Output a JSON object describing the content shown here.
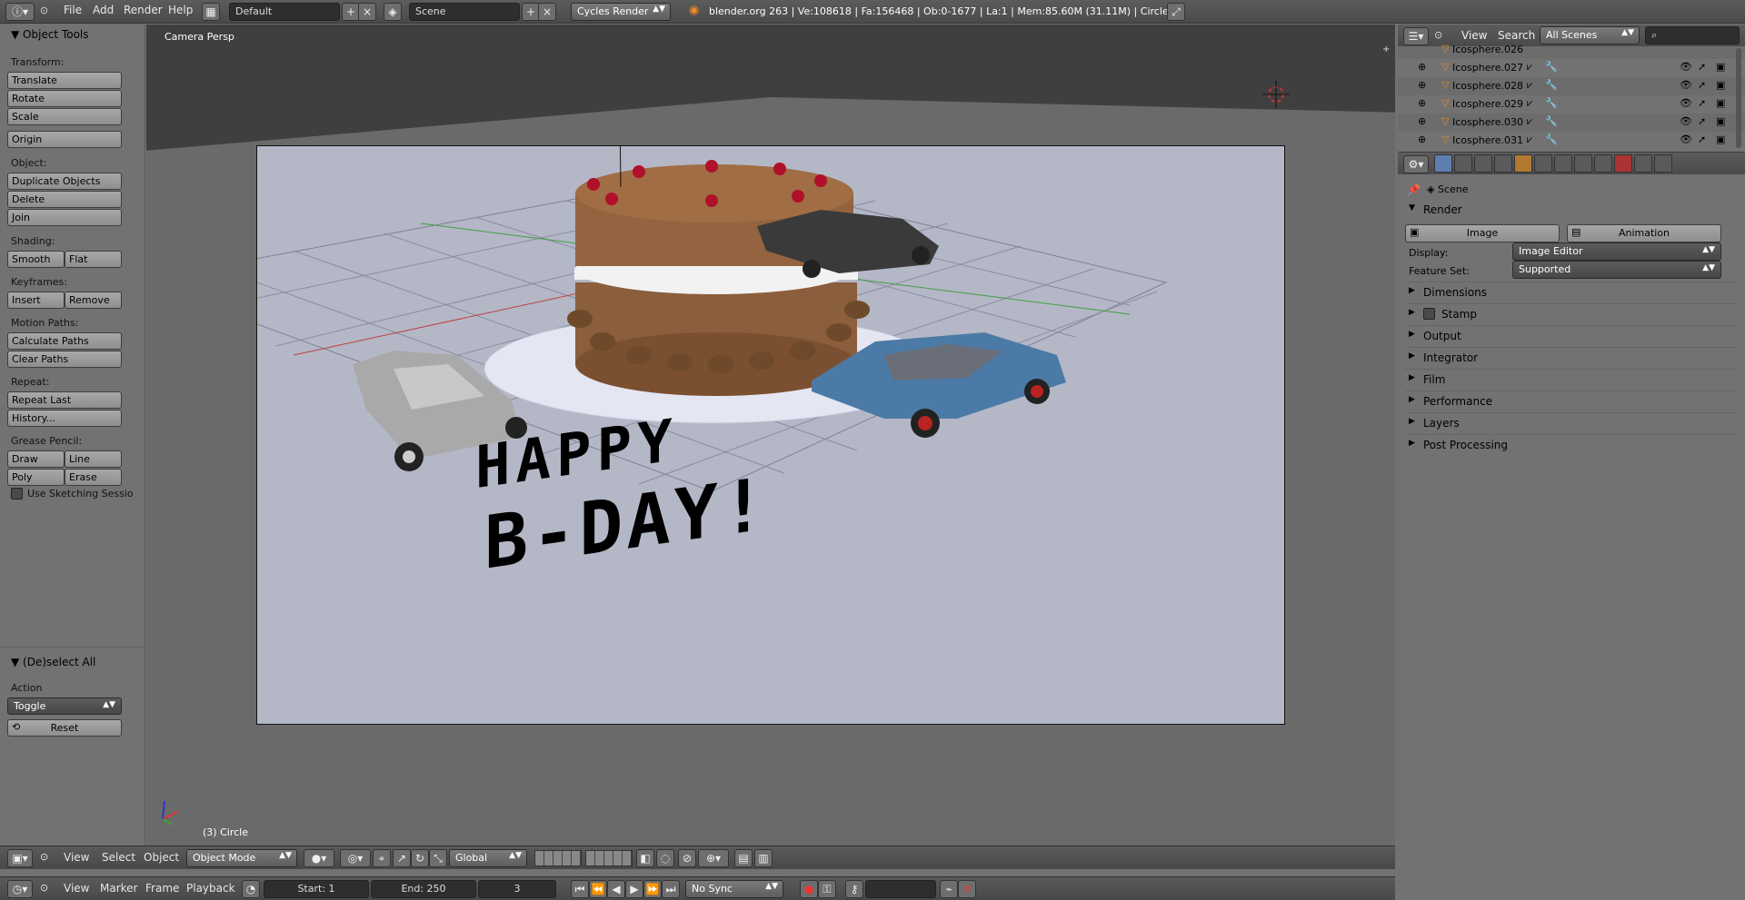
{
  "topbar": {
    "menus": [
      "File",
      "Add",
      "Render",
      "Help"
    ],
    "screen_layout": "Default",
    "scene": "Scene",
    "engine": "Cycles Render",
    "stats": "blender.org 263 | Ve:108618 | Fa:156468 | Ob:0-1677 | La:1 | Mem:85.60M (31.11M) | Circle"
  },
  "tools": {
    "title": "Object Tools",
    "transform_label": "Transform:",
    "translate": "Translate",
    "rotate": "Rotate",
    "scale": "Scale",
    "origin": "Origin",
    "object_label": "Object:",
    "duplicate": "Duplicate Objects",
    "delete": "Delete",
    "join": "Join",
    "shading_label": "Shading:",
    "smooth": "Smooth",
    "flat": "Flat",
    "keyframes_label": "Keyframes:",
    "insert": "Insert",
    "remove": "Remove",
    "motion_label": "Motion Paths:",
    "calc_paths": "Calculate Paths",
    "clear_paths": "Clear Paths",
    "repeat_label": "Repeat:",
    "repeat_last": "Repeat Last",
    "history": "History...",
    "grease_label": "Grease Pencil:",
    "draw": "Draw",
    "line": "Line",
    "poly": "Poly",
    "erase": "Erase",
    "sketching": "Use Sketching Sessio",
    "op_title": "(De)select All",
    "action_label": "Action",
    "action_value": "Toggle",
    "reset": "Reset"
  },
  "viewport": {
    "view_name": "Camera Persp",
    "object_info": "(3) Circle",
    "scene_text_line1": "HAPPY",
    "scene_text_line2": "B-DAY!"
  },
  "view3d_header": {
    "menus": [
      "View",
      "Select",
      "Object"
    ],
    "mode": "Object Mode",
    "orientation": "Global"
  },
  "timeline": {
    "menus": [
      "View",
      "Marker",
      "Frame",
      "Playback"
    ],
    "start": "Start: 1",
    "end": "End: 250",
    "current": "3",
    "sync": "No Sync"
  },
  "outliner": {
    "menus": [
      "View",
      "Search"
    ],
    "filter": "All Scenes",
    "items": [
      "Icosphere.026",
      "Icosphere.027",
      "Icosphere.028",
      "Icosphere.029",
      "Icosphere.030",
      "Icosphere.031"
    ]
  },
  "properties": {
    "context": "Scene",
    "render_title": "Render",
    "image_btn": "Image",
    "animation_btn": "Animation",
    "display_label": "Display:",
    "display_value": "Image Editor",
    "feature_label": "Feature Set:",
    "feature_value": "Supported",
    "sections": [
      "Dimensions",
      "Stamp",
      "Output",
      "Integrator",
      "Film",
      "Performance",
      "Layers",
      "Post Processing"
    ]
  },
  "colors": {
    "cake": "#8b5e3c",
    "cream": "#f2f2f2",
    "cherry": "#b0102a",
    "blue_car": "#4c7aa6",
    "silver_car": "#a9a9a9",
    "dark_car": "#3a3a3a"
  }
}
